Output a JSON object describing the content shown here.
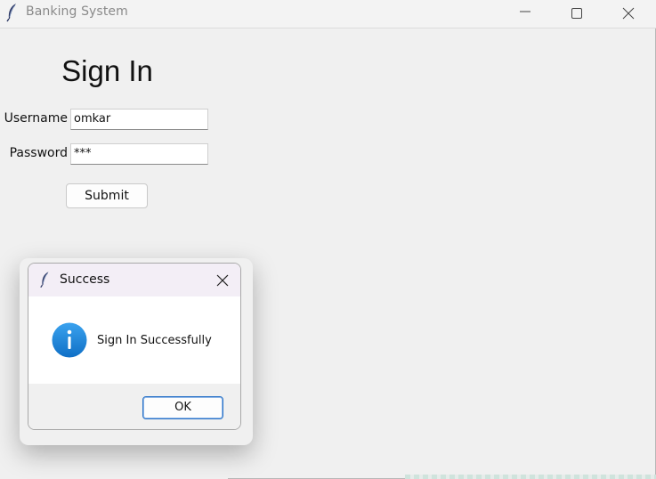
{
  "window": {
    "title": "Banking System",
    "controls": [
      "minimize-icon",
      "maximize-icon",
      "close-icon"
    ]
  },
  "form": {
    "heading": "Sign In",
    "username_label": "Username",
    "username_value": "omkar",
    "password_label": "Password",
    "password_value": "***",
    "submit_label": "Submit"
  },
  "dialog": {
    "title": "Success",
    "icon": "info-icon",
    "message": "Sign In Successfully",
    "ok_label": "OK"
  },
  "colors": {
    "accent": "#2a73c8",
    "info_icon": "#1a84d8",
    "dialog_titlebar": "#f3eef6",
    "window_bg": "#f0f0f0"
  }
}
